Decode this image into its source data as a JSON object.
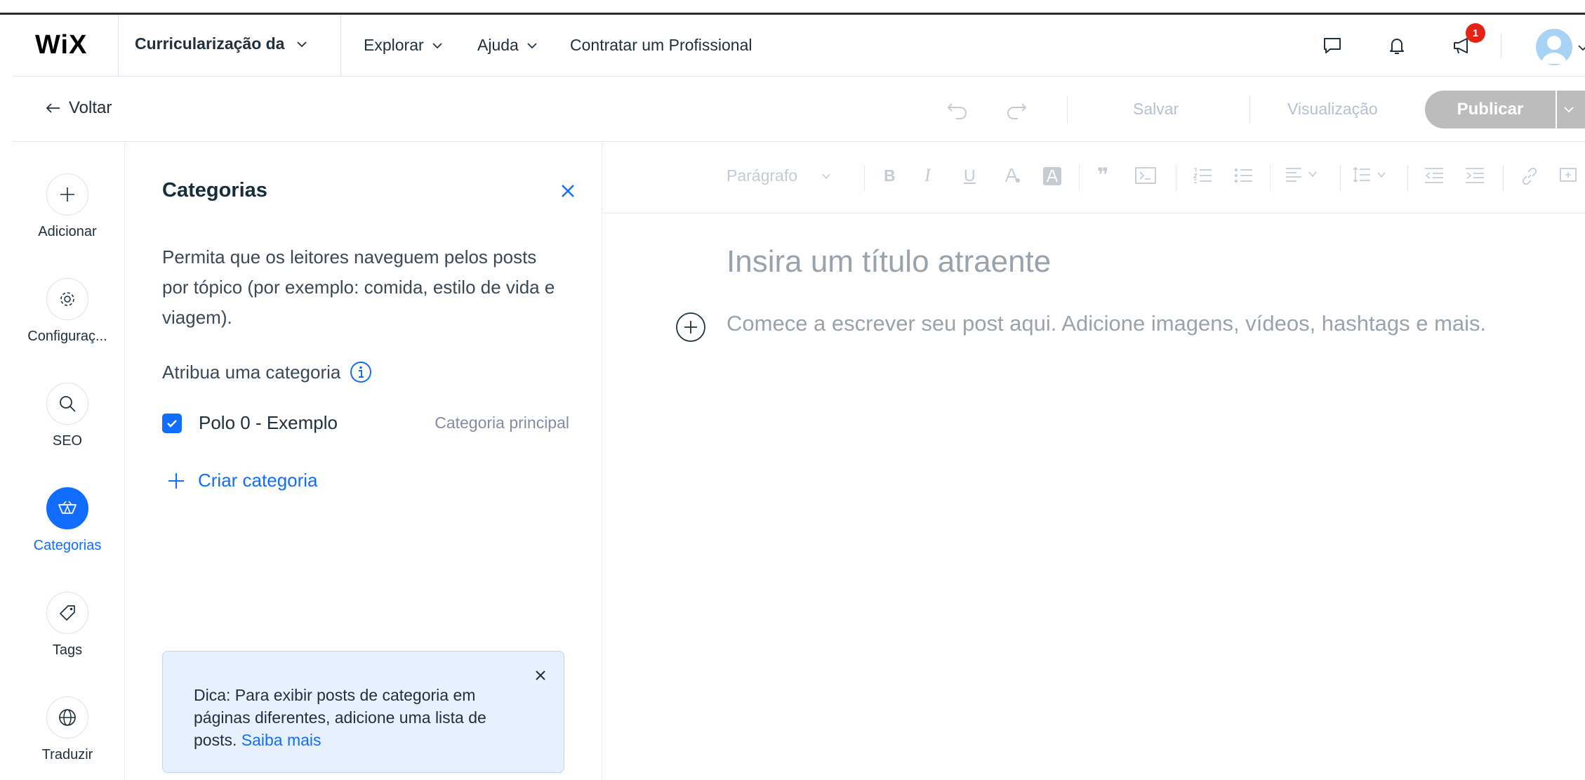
{
  "header": {
    "logo": "WiX",
    "site_name": "Curricularização da",
    "nav": [
      "Explorar",
      "Ajuda",
      "Contratar um Profissional"
    ],
    "notification_badge": "1"
  },
  "toolbar": {
    "back_label": "Voltar",
    "save_label": "Salvar",
    "preview_label": "Visualização",
    "publish_label": "Publicar"
  },
  "rail": {
    "add": "Adicionar",
    "settings": "Configuraç...",
    "seo": "SEO",
    "categories": "Categorias",
    "tags": "Tags",
    "translate": "Traduzir"
  },
  "panel": {
    "title": "Categorias",
    "description": "Permita que os leitores naveguem pelos posts por tópico (por exemplo: comida, estilo de vida e viagem).",
    "assign_label": "Atribua uma categoria",
    "category": {
      "name": "Polo 0 - Exemplo",
      "checked": true,
      "tag": "Categoria principal"
    },
    "create_label": "Criar categoria",
    "tip_text": "Dica: Para exibir posts de categoria em páginas diferentes, adicione uma lista de posts.",
    "tip_link": "Saiba mais"
  },
  "editor": {
    "paragraph_select": "Parágrafo",
    "title_placeholder": "Insira um título atraente",
    "body_placeholder": "Comece a escrever seu post aqui. Adicione imagens, vídeos, hashtags e mais."
  },
  "colors": {
    "accent": "#116dff",
    "publish_disabled": "#bcbcbc",
    "badge": "#e62214",
    "tip_background": "#e7f0ff"
  }
}
